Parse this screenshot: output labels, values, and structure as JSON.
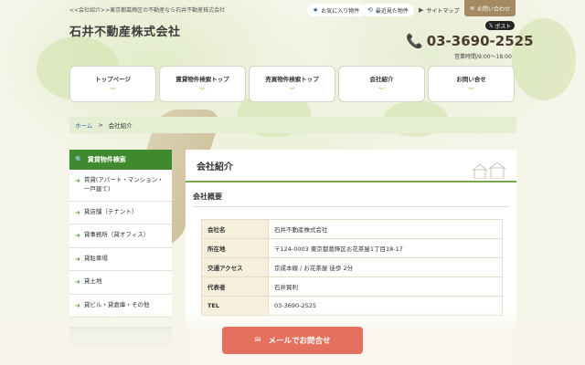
{
  "header": {
    "breadcrumb": "<<会社紹介>>東京都葛飾区の不動産なら石井不動産株式会社",
    "site_title": "石井不動産株式会社",
    "phone": "03-3690-2525",
    "hours": "営業時間/9:00～18:00"
  },
  "util_links": {
    "favorites": "お気に入り物件",
    "recent": "最近見た物件",
    "sitemap": "サイトマップ",
    "contact": "お問い合わせ",
    "x_post": "ポスト"
  },
  "nav": [
    {
      "label": "トップページ"
    },
    {
      "label": "賃貸物件検索トップ"
    },
    {
      "label": "売買物件検索トップ"
    },
    {
      "label": "会社紹介"
    },
    {
      "label": "お問い合せ"
    }
  ],
  "breadcrumb": {
    "home": "ホーム",
    "separator": ">",
    "current": "会社紹介"
  },
  "sidebar": {
    "heading": "賃貸物件検索",
    "items": [
      {
        "label": "賃貸(アパート・マンション・一戸建て)"
      },
      {
        "label": "貸店舗（テナント）"
      },
      {
        "label": "貸事務所（貸オフィス）"
      },
      {
        "label": "貸駐車場"
      },
      {
        "label": "貸土地"
      },
      {
        "label": "貸ビル・貸倉庫・その他"
      }
    ]
  },
  "main": {
    "title": "会社紹介",
    "subtitle": "会社概要",
    "table": [
      {
        "label": "会社名",
        "value": "石井不動産株式会社"
      },
      {
        "label": "所在地",
        "value": "〒124-0003 東京都葛飾区お花茶屋1丁目18-17"
      },
      {
        "label": "交通アクセス",
        "value": "京成本線 / お花茶屋 徒歩 2分"
      },
      {
        "label": "代表者",
        "value": "石井賀利"
      },
      {
        "label": "TEL",
        "value": "03-3690-2525"
      }
    ]
  },
  "floating": {
    "mail_label": "メールでお問合せ"
  },
  "colors": {
    "accent_green": "#3f8a2e",
    "mail_button": "#e5705d",
    "contact_brown": "#a48a63"
  }
}
